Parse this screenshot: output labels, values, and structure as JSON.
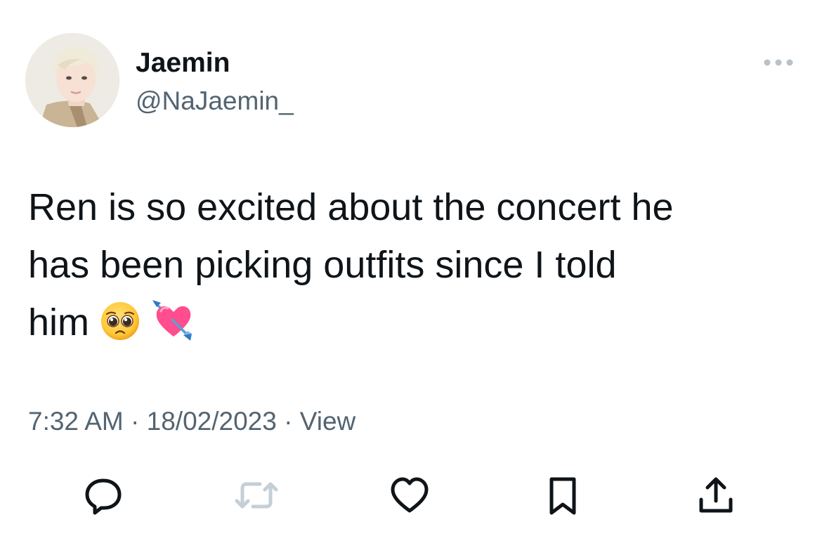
{
  "author": {
    "display_name": "Jaemin",
    "handle": "@NaJaemin_",
    "avatar_icon": "user-avatar-photo"
  },
  "tweet": {
    "text_line_1": "Ren is so excited about the concert he",
    "text_line_2": "has been picking outfits since I told",
    "text_line_3": "him",
    "emojis": [
      "pleading-face-icon",
      "heart-with-arrow-icon"
    ]
  },
  "meta": {
    "time": "7:32 AM",
    "separator": "·",
    "date": "18/02/2023",
    "view_label": "View"
  },
  "actions": [
    {
      "name": "reply",
      "icon": "reply-bubble-icon"
    },
    {
      "name": "retweet",
      "icon": "retweet-icon"
    },
    {
      "name": "like",
      "icon": "heart-outline-icon"
    },
    {
      "name": "bookmark",
      "icon": "bookmark-icon"
    },
    {
      "name": "share",
      "icon": "share-upload-icon"
    }
  ],
  "colors": {
    "text_primary": "#0f1419",
    "text_secondary": "#536471",
    "retweet_disabled": "#c4cfd6"
  }
}
